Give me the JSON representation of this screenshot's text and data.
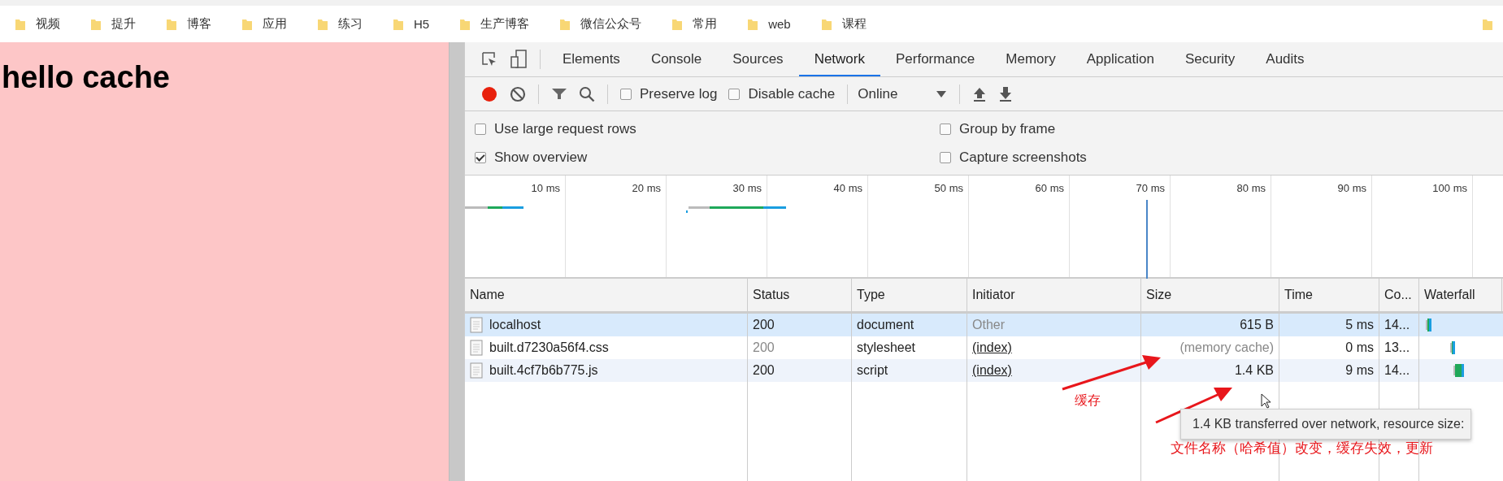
{
  "bookmarks": [
    {
      "label": "视频"
    },
    {
      "label": "提升"
    },
    {
      "label": "博客"
    },
    {
      "label": "应用"
    },
    {
      "label": "练习"
    },
    {
      "label": "H5"
    },
    {
      "label": "生产博客"
    },
    {
      "label": "微信公众号"
    },
    {
      "label": "常用"
    },
    {
      "label": "web"
    },
    {
      "label": "课程"
    }
  ],
  "page": {
    "heading": "hello cache"
  },
  "devtools": {
    "tabs": [
      {
        "label": "Elements",
        "selected": false
      },
      {
        "label": "Console",
        "selected": false
      },
      {
        "label": "Sources",
        "selected": false
      },
      {
        "label": "Network",
        "selected": true
      },
      {
        "label": "Performance",
        "selected": false
      },
      {
        "label": "Memory",
        "selected": false
      },
      {
        "label": "Application",
        "selected": false
      },
      {
        "label": "Security",
        "selected": false
      },
      {
        "label": "Audits",
        "selected": false
      }
    ],
    "toolbar": {
      "recording": true,
      "preserve_log": {
        "label": "Preserve log",
        "checked": false
      },
      "disable_cache": {
        "label": "Disable cache",
        "checked": false
      },
      "throttling": "Online"
    },
    "settings": [
      [
        {
          "label": "Use large request rows",
          "checked": false
        },
        {
          "label": "Group by frame",
          "checked": false
        }
      ],
      [
        {
          "label": "Show overview",
          "checked": true
        },
        {
          "label": "Capture screenshots",
          "checked": false
        }
      ]
    ],
    "overview": {
      "ticks": [
        "10 ms",
        "20 ms",
        "30 ms",
        "40 ms",
        "50 ms",
        "60 ms",
        "70 ms",
        "80 ms",
        "90 ms",
        "100 ms"
      ]
    },
    "table": {
      "columns": [
        "Name",
        "Status",
        "Type",
        "Initiator",
        "Size",
        "Time",
        "Co...",
        "Waterfall"
      ],
      "rows": [
        {
          "name": "localhost",
          "status": "200",
          "type": "document",
          "initiator": "Other",
          "initiator_link": false,
          "size": "615 B",
          "from_cache": false,
          "time": "5 ms",
          "column_7": "14...",
          "selected": true
        },
        {
          "name": "built.d7230a56f4.css",
          "status": "200",
          "type": "stylesheet",
          "initiator": "(index)",
          "initiator_link": true,
          "size": "(memory cache)",
          "from_cache": true,
          "time": "0 ms",
          "column_7": "13...",
          "selected": false
        },
        {
          "name": "built.4cf7b6b775.js",
          "status": "200",
          "type": "script",
          "initiator": "(index)",
          "initiator_link": true,
          "size": "1.4 KB",
          "from_cache": false,
          "time": "9 ms",
          "column_7": "14...",
          "selected": false
        }
      ]
    },
    "tooltip": "1.4 KB transferred over network, resource size:"
  },
  "annotations": {
    "cache_note": "缓存",
    "hash_note": "文件名称（哈希值）改变，缓存失效，更新"
  }
}
